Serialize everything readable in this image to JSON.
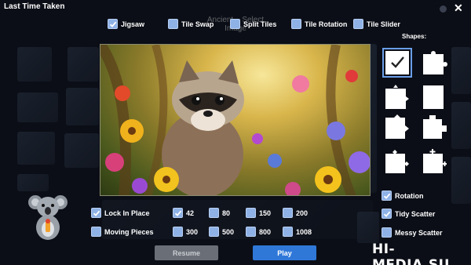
{
  "header": {
    "title": "Last Time Taken"
  },
  "ghost_title": "Ancient... Select Image",
  "top_options": [
    {
      "label": "Jigsaw",
      "checked": true
    },
    {
      "label": "Tile Swap",
      "checked": false
    },
    {
      "label": "Split Tiles",
      "checked": false
    },
    {
      "label": "Tile Rotation",
      "checked": false
    },
    {
      "label": "Tile Slider",
      "checked": false
    }
  ],
  "preview": {
    "description_icon": "raccoon-in-flowers-image"
  },
  "shapes": {
    "title": "Shapes:",
    "items": [
      {
        "name": "shape-1",
        "selected": true
      },
      {
        "name": "shape-2",
        "selected": false
      },
      {
        "name": "shape-3",
        "selected": false
      },
      {
        "name": "shape-4",
        "selected": false
      },
      {
        "name": "shape-5",
        "selected": false
      },
      {
        "name": "shape-6",
        "selected": false
      },
      {
        "name": "shape-7",
        "selected": false
      },
      {
        "name": "shape-8",
        "selected": false
      }
    ]
  },
  "options": {
    "lock_in_place": {
      "label": "Lock In Place",
      "checked": true
    },
    "moving_pieces": {
      "label": "Moving Pieces",
      "checked": false
    },
    "rotation": {
      "label": "Rotation",
      "checked": true
    },
    "tidy_scatter": {
      "label": "Tidy Scatter",
      "checked": true
    },
    "messy_scatter": {
      "label": "Messy Scatter",
      "checked": false
    }
  },
  "piece_counts": [
    {
      "label": "42",
      "checked": true
    },
    {
      "label": "80",
      "checked": false
    },
    {
      "label": "150",
      "checked": false
    },
    {
      "label": "200",
      "checked": false
    },
    {
      "label": "300",
      "checked": false
    },
    {
      "label": "500",
      "checked": false
    },
    {
      "label": "800",
      "checked": false
    },
    {
      "label": "1008",
      "checked": false
    }
  ],
  "buttons": {
    "resume": "Resume",
    "play": "Play"
  },
  "watermark": "HI-MEDIA.SU",
  "colors": {
    "checkbox": "#8fb2e6",
    "play": "#2f78d8",
    "resume": "#6a6e76",
    "background": "#0b0e16"
  }
}
